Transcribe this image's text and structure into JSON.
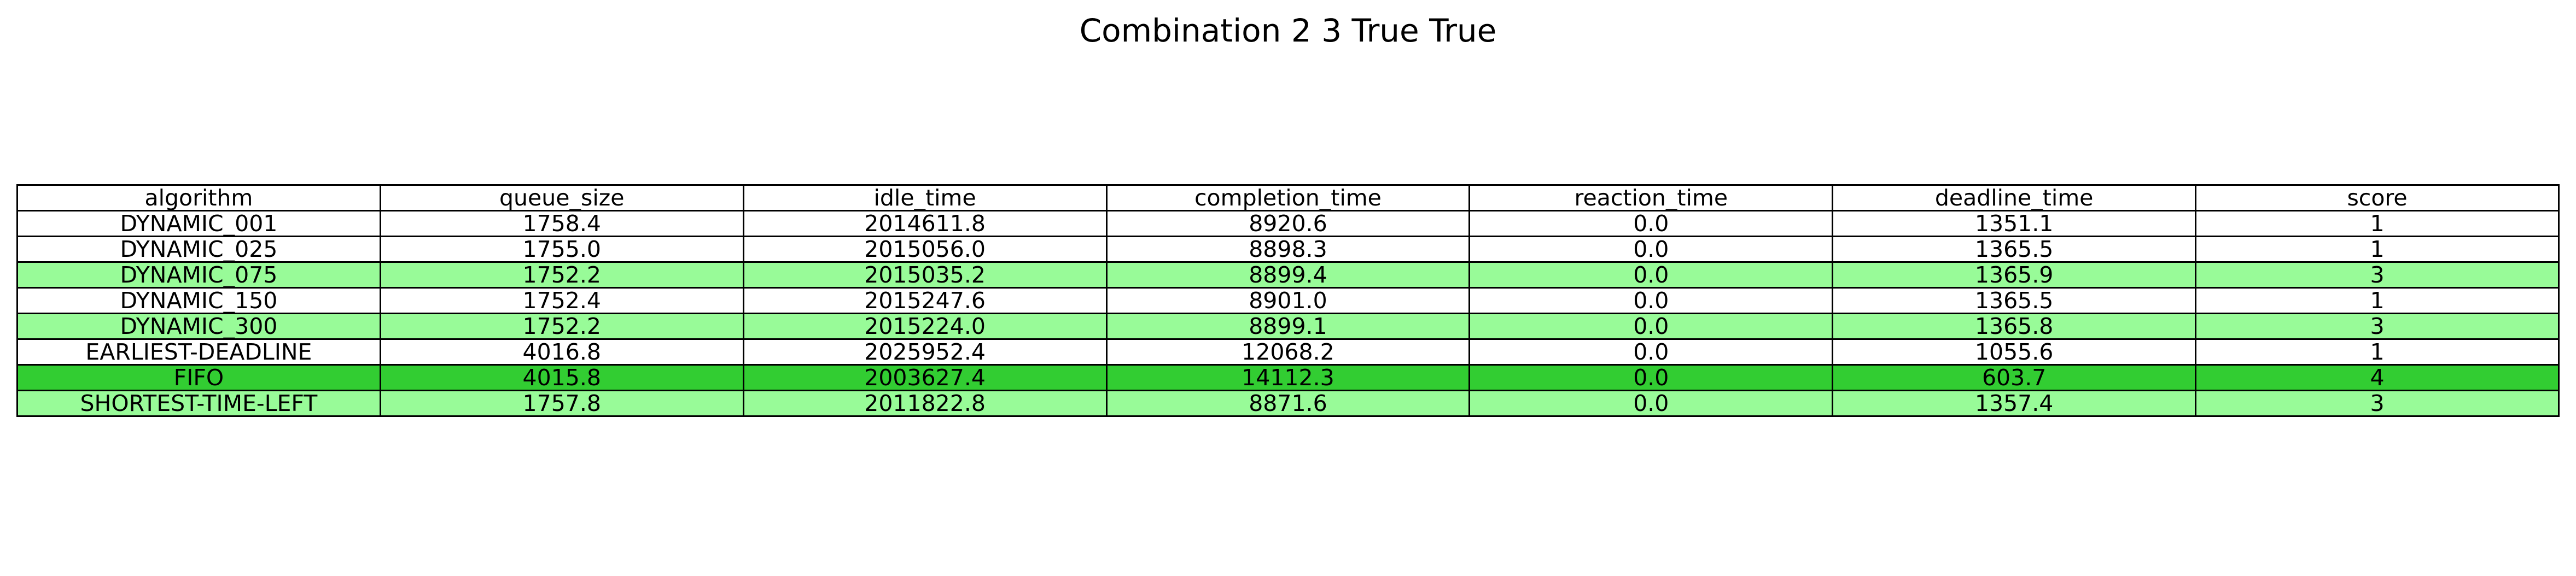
{
  "title": "Combination 2 3 True True",
  "colors": {
    "none": "#ffffff",
    "light_green": "#98fb98",
    "dark_green": "#32cd32",
    "border": "#000000"
  },
  "chart_data": {
    "type": "table",
    "title": "Combination 2 3 True True",
    "columns": [
      "algorithm",
      "queue_size",
      "idle_time",
      "completion_time",
      "reaction_time",
      "deadline_time",
      "score"
    ],
    "rows": [
      {
        "cells": [
          "DYNAMIC_001",
          "1758.4",
          "2014611.8",
          "8920.6",
          "0.0",
          "1351.1",
          "1"
        ],
        "highlight": "none"
      },
      {
        "cells": [
          "DYNAMIC_025",
          "1755.0",
          "2015056.0",
          "8898.3",
          "0.0",
          "1365.5",
          "1"
        ],
        "highlight": "none"
      },
      {
        "cells": [
          "DYNAMIC_075",
          "1752.2",
          "2015035.2",
          "8899.4",
          "0.0",
          "1365.9",
          "3"
        ],
        "highlight": "light_green"
      },
      {
        "cells": [
          "DYNAMIC_150",
          "1752.4",
          "2015247.6",
          "8901.0",
          "0.0",
          "1365.5",
          "1"
        ],
        "highlight": "none"
      },
      {
        "cells": [
          "DYNAMIC_300",
          "1752.2",
          "2015224.0",
          "8899.1",
          "0.0",
          "1365.8",
          "3"
        ],
        "highlight": "light_green"
      },
      {
        "cells": [
          "EARLIEST-DEADLINE",
          "4016.8",
          "2025952.4",
          "12068.2",
          "0.0",
          "1055.6",
          "1"
        ],
        "highlight": "none"
      },
      {
        "cells": [
          "FIFO",
          "4015.8",
          "2003627.4",
          "14112.3",
          "0.0",
          "603.7",
          "4"
        ],
        "highlight": "dark_green"
      },
      {
        "cells": [
          "SHORTEST-TIME-LEFT",
          "1757.8",
          "2011822.8",
          "8871.6",
          "0.0",
          "1357.4",
          "3"
        ],
        "highlight": "light_green"
      }
    ]
  }
}
